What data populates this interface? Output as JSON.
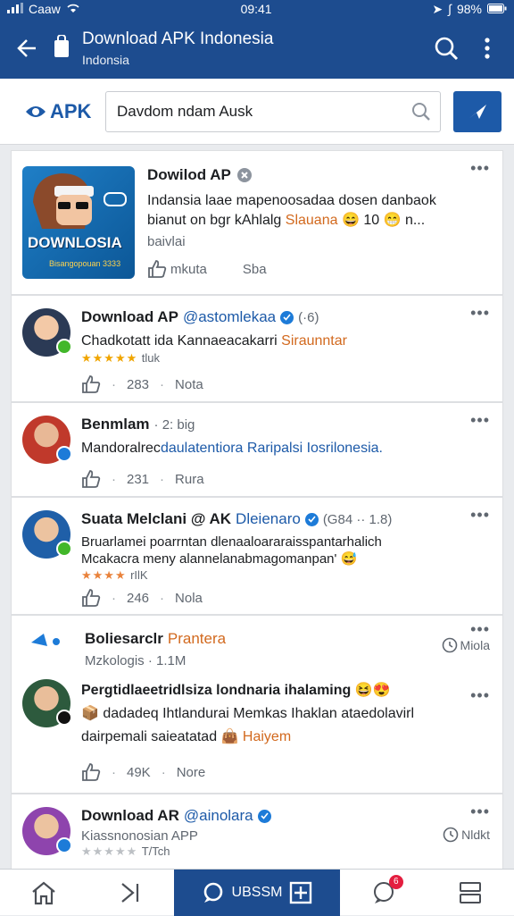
{
  "status_bar": {
    "carrier": "Caaw",
    "time": "09:41",
    "battery": "98%"
  },
  "app_bar": {
    "title": "Download APK Indonesia",
    "subtitle": "Indonsia"
  },
  "search": {
    "logo_text": "APK",
    "value": "Davdom ndam Ausk"
  },
  "featured": {
    "title": "Dowilod AP",
    "desc_line1": "Indansia laae mapenoosadaa dosen danbaok",
    "desc_line2_prefix": "bianut on bgr kAhlalg",
    "desc_line2_highlight": "Slauana",
    "desc_line2_suffix": "10",
    "desc_line2_tail": "n...",
    "meta": "baivlai",
    "action_like": "mkuta",
    "action_share": "Sba",
    "thumb_label": "DOWNLOSIA",
    "thumb_sub": "Bisangopouan 3333"
  },
  "posts": [
    {
      "name": "Download AP",
      "handle": "@astomlekaa",
      "meta": "(·6)",
      "text_prefix": "Chadkotatt ida Kannaeacakarri",
      "text_highlight": "Siraunntar",
      "stars": "★★★★★",
      "sub": "tluk",
      "likes": "283",
      "action": "Nota"
    },
    {
      "name": "Benmlam",
      "handle": "",
      "meta": "· 2: big",
      "text_prefix": "Mandoralrec",
      "text_highlight": "daulatentiora Raripalsi Iosrilonesia.",
      "likes": "231",
      "action": "Rura"
    },
    {
      "name": "Suata Melclani @ AK",
      "handle": "Dleienaro",
      "meta": "(G84 ·· 1.8)",
      "text_line1": "Bruarlamei poarrntan dlenaaloararaisspantarhalich",
      "text_line2": "Mcakacra meny alannelanabmagomanpan'",
      "stars": "★★★★",
      "sub": "rIlK",
      "likes": "246",
      "action": "Nola"
    },
    {
      "name": "Boliesarclr",
      "handle": "",
      "tag": "Prantera",
      "sub": "Mzkologis · 1.1M",
      "time": "Miola"
    },
    {
      "name": "",
      "text_line1": "Pergtidlaeetridlsiza londnaria ihalaming",
      "text_line2": "dadadeq Ihtlandurai Memkas Ihaklan ataedolavirl",
      "text_line3_prefix": "dairpemali saieatatad",
      "text_line3_highlight": "Haiyem",
      "likes": "49K",
      "action": "Nore"
    },
    {
      "name": "Download AR",
      "handle": "@ainolara",
      "sub1": "Kiassnonosian APP",
      "stars": "★★★★★",
      "sub": "T/Tch",
      "time": "Nldkt"
    }
  ],
  "bottom_nav": {
    "active_label": "UBSSM",
    "badge": "6"
  },
  "colors": {
    "primary": "#1d4c8f",
    "accent": "#1d5aa8",
    "link": "#1d5aa8",
    "highlight": "#d2691e"
  }
}
